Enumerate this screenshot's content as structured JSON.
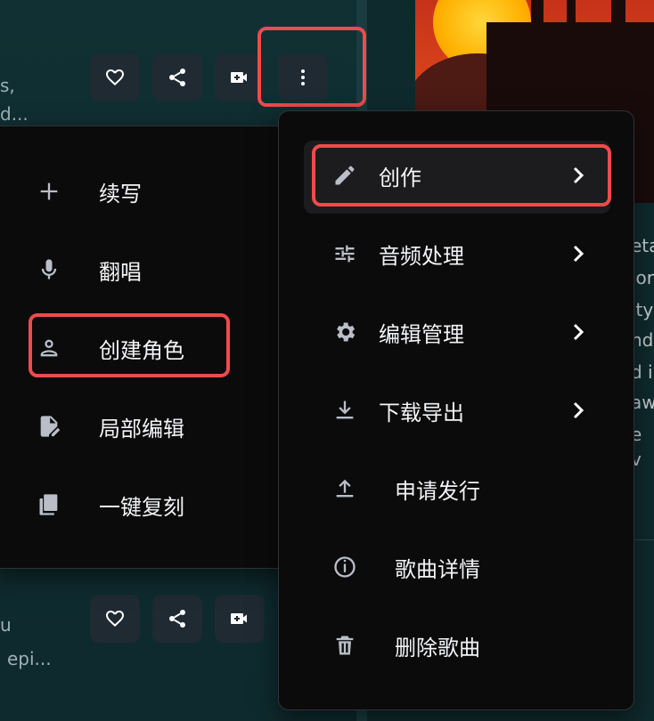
{
  "background": {
    "left_snippets": [
      "s,",
      "d...",
      "u",
      "epi..."
    ],
    "right_snippets": [
      "eta",
      "ior",
      "ity",
      "nd",
      "d i",
      "aw",
      "e v"
    ]
  },
  "top_actions": {
    "like_icon": "heart-icon",
    "share_icon": "share-icon",
    "video_icon": "video-add-icon",
    "more_icon": "more-vertical-icon"
  },
  "bottom_actions": {
    "like_icon": "heart-icon",
    "share_icon": "share-icon",
    "video_icon": "video-add-icon"
  },
  "submenu": {
    "items": [
      {
        "label": "续写",
        "icon": "plus-icon"
      },
      {
        "label": "翻唱",
        "icon": "microphone-icon"
      },
      {
        "label": "创建角色",
        "icon": "person-icon"
      },
      {
        "label": "局部编辑",
        "icon": "edit-file-icon"
      },
      {
        "label": "一键复刻",
        "icon": "copy-icon"
      }
    ]
  },
  "main_menu": {
    "items": [
      {
        "label": "创作",
        "icon": "pencil-icon",
        "has_submenu": true
      },
      {
        "label": "音频处理",
        "icon": "sliders-icon",
        "has_submenu": true
      },
      {
        "label": "编辑管理",
        "icon": "gear-icon",
        "has_submenu": true
      },
      {
        "label": "下载导出",
        "icon": "download-icon",
        "has_submenu": true
      },
      {
        "label": "申请发行",
        "icon": "upload-icon",
        "has_submenu": false
      },
      {
        "label": "歌曲详情",
        "icon": "info-icon",
        "has_submenu": false
      },
      {
        "label": "删除歌曲",
        "icon": "trash-icon",
        "has_submenu": false
      }
    ]
  },
  "colors": {
    "highlight": "#ef4b4b",
    "menu_bg": "#0b0b0c",
    "page_bg": "#0f2a2d"
  }
}
